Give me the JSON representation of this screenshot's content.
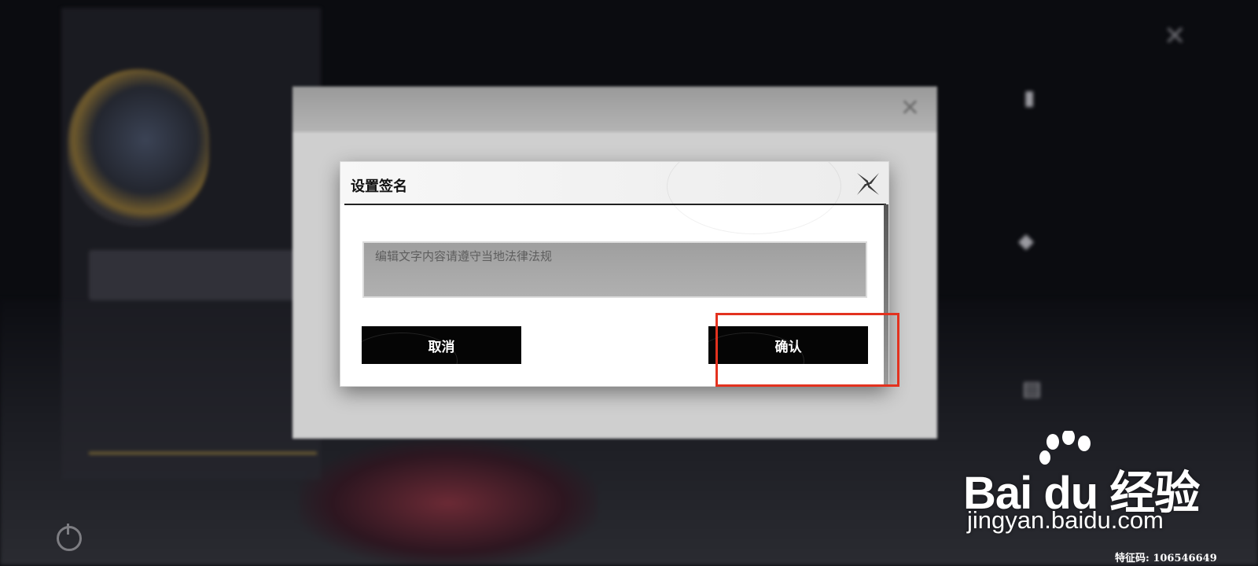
{
  "dialog": {
    "title": "设置签名",
    "input_placeholder": "编辑文字内容请遵守当地法律法规",
    "cancel_label": "取消",
    "confirm_label": "确认"
  },
  "watermark": {
    "logo_text": "Bai du 经验",
    "url": "jingyan.baidu.com",
    "feature_code": "特征码: 106546649"
  },
  "colors": {
    "highlight": "#e3321f",
    "button_bg": "#050505",
    "dialog_bg": "#ffffff"
  },
  "icons": {
    "dialog_close": "close-star-icon",
    "background_power": "power-icon",
    "top_close": "close-icon"
  }
}
